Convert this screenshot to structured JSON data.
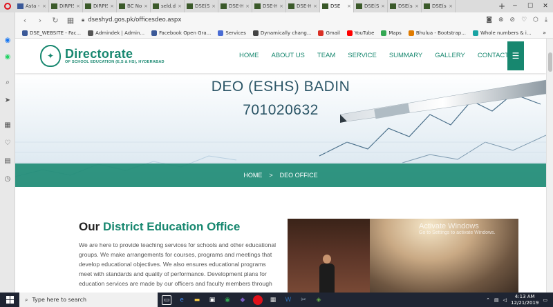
{
  "browser": {
    "tabs": [
      {
        "label": "Asta - B",
        "icon": "facebook"
      },
      {
        "label": "DIRPIS",
        "icon": "dse"
      },
      {
        "label": "DIRPIS",
        "icon": "dse"
      },
      {
        "label": "BC Nom",
        "icon": "dse"
      },
      {
        "label": "seld.dse",
        "icon": "dse"
      },
      {
        "label": "DSE(S) -",
        "icon": "dse"
      },
      {
        "label": "DSE-Hy",
        "icon": "dse"
      },
      {
        "label": "DSE-Hy",
        "icon": "dse"
      },
      {
        "label": "DSE-Hy",
        "icon": "dse"
      },
      {
        "label": "DSE",
        "icon": "dse",
        "active": true
      },
      {
        "label": "DSE(S) I",
        "icon": "dse"
      },
      {
        "label": "DSE(s) I",
        "icon": "dse"
      },
      {
        "label": "DSE(s) I",
        "icon": "dse"
      }
    ],
    "url": "dseshyd.gos.pk/officesdeo.aspx",
    "bookmarks": [
      {
        "label": "DSE_WEBSITE - Fac...",
        "color": "#3b5998"
      },
      {
        "label": "Admindek | Admin...",
        "color": "#555555"
      },
      {
        "label": "Facebook Open Gra...",
        "color": "#3b5998"
      },
      {
        "label": "Services",
        "color": "#4a6cd4"
      },
      {
        "label": "Dynamically chang...",
        "color": "#444444"
      },
      {
        "label": "Gmail",
        "color": "#d93025"
      },
      {
        "label": "YouTube",
        "color": "#ff0000"
      },
      {
        "label": "Maps",
        "color": "#34a853"
      },
      {
        "label": "Bhulua - Bootstrap...",
        "color": "#e07b00"
      },
      {
        "label": "Whole numbers & i...",
        "color": "#19a3a3"
      }
    ],
    "bookmarks_more": "»"
  },
  "site": {
    "logo_title": "Directorate",
    "logo_subtitle": "OF SCHOOL EDUCATION (E,S & HS), HYDERABAD",
    "menu": [
      "HOME",
      "ABOUT US",
      "TEAM",
      "SERVICE",
      "SUMMARY",
      "GALLERY",
      "CONTACT US"
    ],
    "hero_title": "DEO (ESHS) BADIN",
    "hero_number": "701020632",
    "breadcrumb_home": "HOME",
    "breadcrumb_sep": ">",
    "breadcrumb_current": "DEO OFFICE",
    "about_title_plain": "Our",
    "about_title_accent": "District Education Office",
    "about_text": "We are here to provide teaching services for schools and other educational groups. We make arrangements for courses, programs and meetings that develop educational objectives. We also ensures educational programs meet with standards and quality of performance. Development plans for education services are made by our officers and faculty members through",
    "accent_color": "#17876f"
  },
  "watermark": {
    "line1": "Activate Windows",
    "line2": "Go to Settings to activate Windows."
  },
  "taskbar": {
    "search_placeholder": "Type here to search",
    "time": "4:13 AM",
    "date": "12/21/2019"
  }
}
